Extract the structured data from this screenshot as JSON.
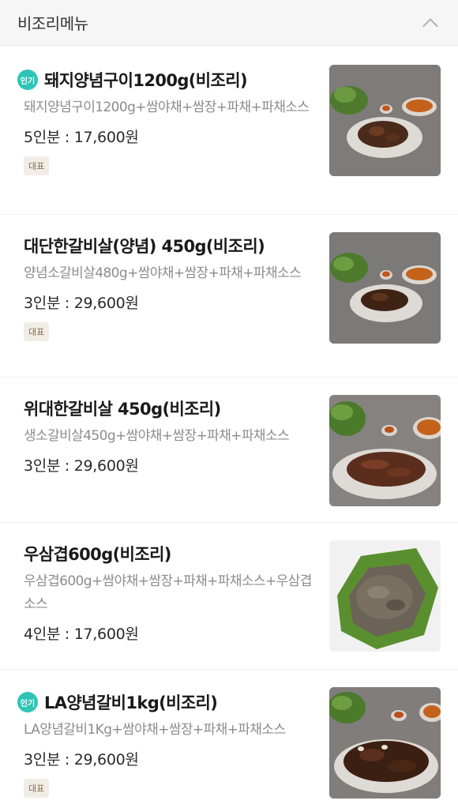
{
  "header": {
    "title": "비조리메뉴",
    "collapse_icon": "chevron-up-icon"
  },
  "badges": {
    "popular": "인기",
    "representative": "대표"
  },
  "items": [
    {
      "name": "돼지양념구이1200g(비조리)",
      "desc": "돼지양념구이1200g+쌈야채+쌈장+파채+파채소스",
      "price": "5인분 : 17,600원",
      "popular": true,
      "representative": true
    },
    {
      "name": "대단한갈비살(양념) 450g(비조리)",
      "desc": "양념소갈비살480g+쌈야채+쌈장+파채+파채소스",
      "price": "3인분 : 29,600원",
      "popular": false,
      "representative": true
    },
    {
      "name": "위대한갈비살 450g(비조리)",
      "desc": "생소갈비살450g+쌈야채+쌈장+파채+파채소스",
      "price": "3인분 : 29,600원",
      "popular": false,
      "representative": false
    },
    {
      "name": "우삼겹600g(비조리)",
      "desc": "우삼겹600g+쌈야채+쌈장+파채+파채소스+우삼겹소스",
      "price": "4인분 : 17,600원",
      "popular": false,
      "representative": false
    },
    {
      "name": "LA양념갈비1kg(비조리)",
      "desc": "LA양념갈비1Kg+쌈야채+쌈장+파채+파채소스",
      "price": "3인분 : 29,600원",
      "popular": true,
      "representative": true
    }
  ]
}
